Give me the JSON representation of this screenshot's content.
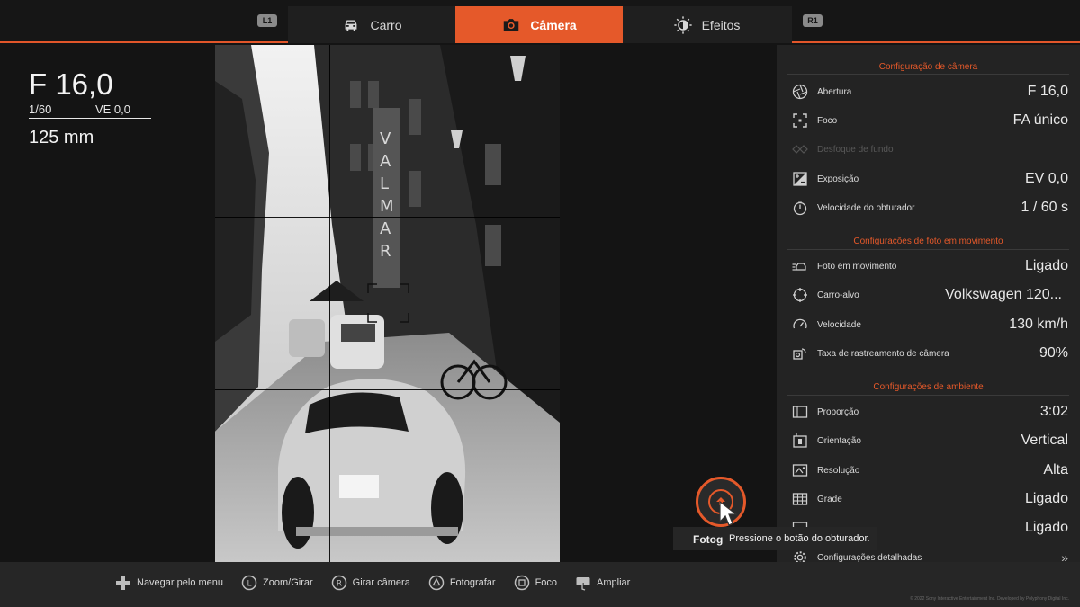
{
  "tabs": {
    "left_shoulder": "L1",
    "right_shoulder": "R1",
    "items": [
      {
        "label": "Carro",
        "icon": "car-icon"
      },
      {
        "label": "Câmera",
        "icon": "camera-icon"
      },
      {
        "label": "Efeitos",
        "icon": "effects-icon"
      }
    ]
  },
  "readout": {
    "aperture": "F 16,0",
    "shutter": "1/60",
    "ev": "VE 0,0",
    "focal": "125 mm"
  },
  "panel": {
    "camera_title": "Configuração de câmera",
    "camera_rows": [
      {
        "label": "Abertura",
        "value": "F 16,0",
        "icon": "aperture-icon"
      },
      {
        "label": "Foco",
        "value": "FA único",
        "icon": "focus-icon"
      },
      {
        "label": "Desfoque de fundo",
        "value": "",
        "icon": "bokeh-icon",
        "disabled": true
      },
      {
        "label": "Exposição",
        "value": "EV 0,0",
        "icon": "exposure-icon"
      },
      {
        "label": "Velocidade do obturador",
        "value": "1 / 60 s",
        "icon": "timer-icon"
      }
    ],
    "motion_title": "Configurações de foto em movimento",
    "motion_rows": [
      {
        "label": "Foto em movimento",
        "value": "Ligado",
        "icon": "motion-icon"
      },
      {
        "label": "Carro-alvo",
        "value": "Volkswagen 120...",
        "icon": "target-icon"
      },
      {
        "label": "Velocidade",
        "value": "130 km/h",
        "icon": "speedometer-icon"
      },
      {
        "label": "Taxa de rastreamento de câmera",
        "value": "90%",
        "icon": "tracking-icon"
      }
    ],
    "env_title": "Configurações de ambiente",
    "env_rows": [
      {
        "label": "Proporção",
        "value": "3:02",
        "icon": "ratio-icon"
      },
      {
        "label": "Orientação",
        "value": "Vertical",
        "icon": "orientation-icon"
      },
      {
        "label": "Resolução",
        "value": "Alta",
        "icon": "resolution-icon"
      },
      {
        "label": "Grade",
        "value": "Ligado",
        "icon": "grid-icon"
      },
      {
        "label": "",
        "value": "Ligado",
        "icon": "frame-icon"
      }
    ],
    "detail_label": "Configurações detalhadas",
    "detail_chevron": "»"
  },
  "shutter": {
    "label": "Fotografar",
    "tooltip": "Pressione o botão do obturador."
  },
  "hints": [
    {
      "label": "Navegar pelo menu",
      "icon": "dpad-icon"
    },
    {
      "label": "Zoom/Girar",
      "icon": "l-stick-icon",
      "glyph": "L"
    },
    {
      "label": "Girar câmera",
      "icon": "r-stick-icon",
      "glyph": "R"
    },
    {
      "label": "Fotografar",
      "icon": "triangle-button-icon"
    },
    {
      "label": "Foco",
      "icon": "square-button-icon"
    },
    {
      "label": "Ampliar",
      "icon": "touchpad-icon"
    }
  ],
  "copyright": "© 2022 Sony Interactive Entertainment Inc. Developed by Polyphony Digital Inc.",
  "colors": {
    "accent": "#e5592a",
    "panel": "#232323",
    "background": "#141414"
  }
}
